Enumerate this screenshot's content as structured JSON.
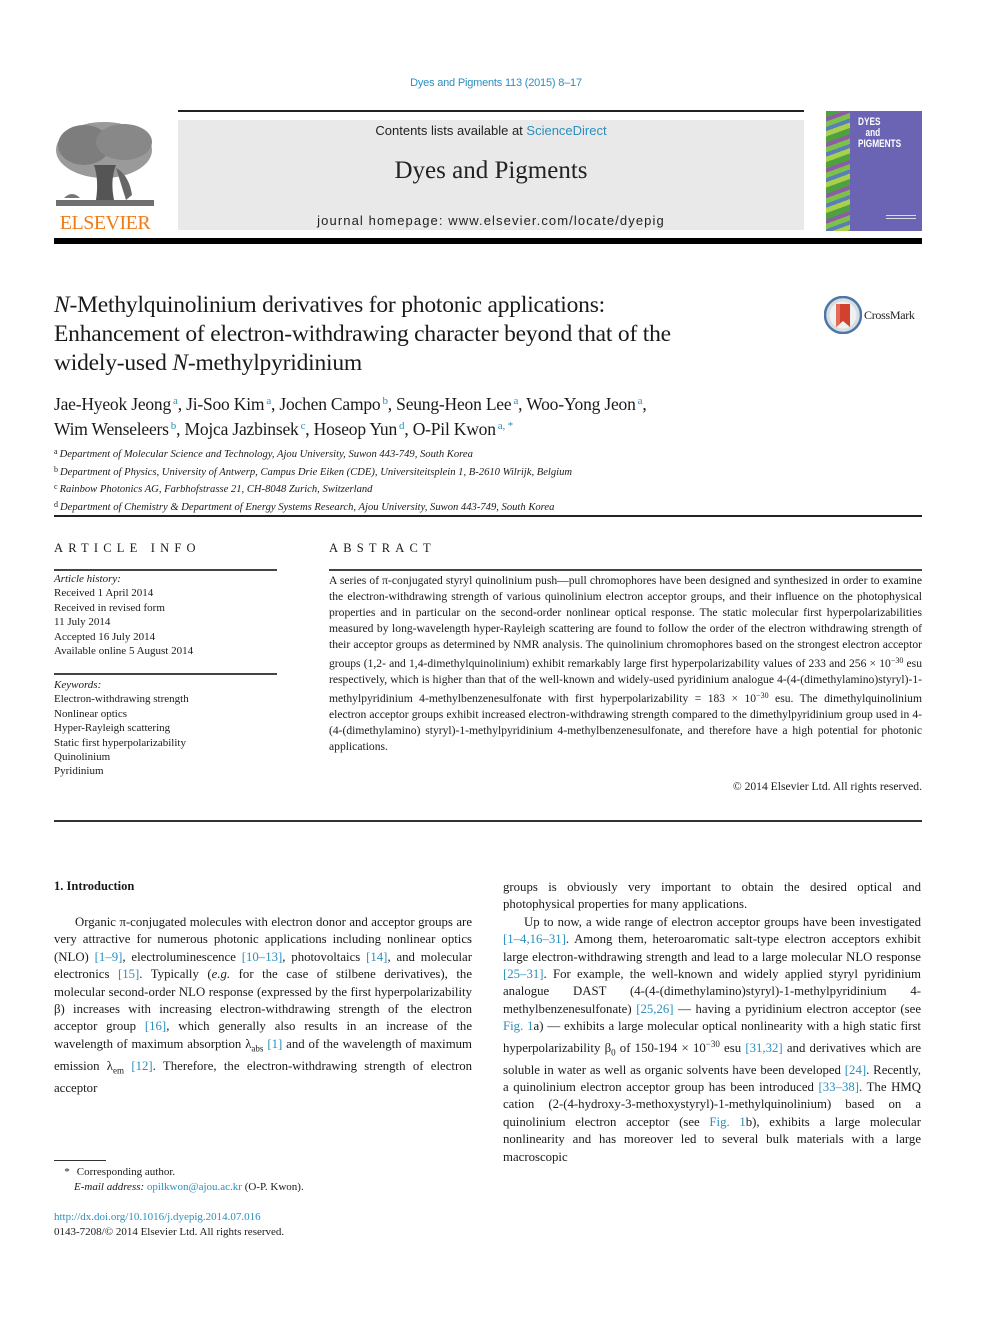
{
  "header": {
    "citation": "Dyes and Pigments 113 (2015) 8–17",
    "contents_prefix": "Contents lists available at ",
    "contents_link": "ScienceDirect",
    "journal_name": "Dyes and Pigments",
    "homepage": "journal homepage: www.elsevier.com/locate/dyepig",
    "publisher_logo": "ELSEVIER",
    "cover": {
      "line1": "DYES",
      "line2": "and",
      "line3": "PIGMENTS"
    },
    "crossmark_label": "CrossMark"
  },
  "article": {
    "title": {
      "line1_italic": "N",
      "line1_rest": "-Methylquinolinium derivatives for photonic applications:",
      "line2": "Enhancement of electron-withdrawing character beyond that of the",
      "line3_pre": "widely-used ",
      "line3_italic": "N",
      "line3_rest": "-methylpyridinium"
    },
    "authors": [
      {
        "name": "Jae-Hyeok Jeong",
        "aff": "a",
        "sep": ", "
      },
      {
        "name": "Ji-Soo Kim",
        "aff": "a",
        "sep": ", "
      },
      {
        "name": "Jochen Campo",
        "aff": "b",
        "sep": ", "
      },
      {
        "name": "Seung-Heon Lee",
        "aff": "a",
        "sep": ", "
      },
      {
        "name": "Woo-Yong Jeon",
        "aff": "a",
        "sep": ","
      },
      {
        "name": "Wim Wenseleers",
        "aff": "b",
        "sep": ", "
      },
      {
        "name": "Mojca Jazbinsek",
        "aff": "c",
        "sep": ", "
      },
      {
        "name": "Hoseop Yun",
        "aff": "d",
        "sep": ", "
      },
      {
        "name": "O-Pil Kwon",
        "aff": "a, *",
        "sep": ""
      }
    ],
    "affiliations": [
      {
        "key": "a",
        "text": "Department of Molecular Science and Technology, Ajou University, Suwon 443-749, South Korea"
      },
      {
        "key": "b",
        "text": "Department of Physics, University of Antwerp, Campus Drie Eiken (CDE), Universiteitsplein 1, B-2610 Wilrijk, Belgium"
      },
      {
        "key": "c",
        "text": "Rainbow Photonics AG, Farbhofstrasse 21, CH-8048 Zurich, Switzerland"
      },
      {
        "key": "d",
        "text": "Department of Chemistry & Department of Energy Systems Research, Ajou University, Suwon 443-749, South Korea"
      }
    ]
  },
  "article_info": {
    "label": "ARTICLE INFO",
    "history_head": "Article history:",
    "history": [
      "Received 1 April 2014",
      "Received in revised form",
      "11 July 2014",
      "Accepted 16 July 2014",
      "Available online 5 August 2014"
    ],
    "keywords_head": "Keywords:",
    "keywords": [
      "Electron-withdrawing strength",
      "Nonlinear optics",
      "Hyper-Rayleigh scattering",
      "Static first hyperpolarizability",
      "Quinolinium",
      "Pyridinium"
    ]
  },
  "abstract": {
    "label": "ABSTRACT",
    "part1": "A series of π-conjugated styryl quinolinium push—pull chromophores have been designed and synthesized in order to examine the electron-withdrawing strength of various quinolinium electron acceptor groups, and their influence on the photophysical properties and in particular on the second-order nonlinear optical response. The static molecular first hyperpolarizabilities measured by long-wavelength hyper-Rayleigh scattering are found to follow the order of the electron withdrawing strength of their acceptor groups as determined by NMR analysis. The quinolinium chromophores based on the strongest electron acceptor groups (1,2- and 1,4-dimethylquinolinium) exhibit remarkably large first hyperpolarizability values of 233 and 256 × 10",
    "exp1": "−30",
    "part2": " esu respectively, which is higher than that of the well-known and widely-used pyridinium analogue 4-(4-(dimethylamino)styryl)-1-methylpyridinium 4-methylbenzenesulfonate with first hyperpolarizability = 183 × 10",
    "exp2": "−30",
    "part3": " esu. The dimethylquinolinium electron acceptor groups exhibit increased electron-withdrawing strength compared to the dimethylpyridinium group used in 4-(4-(dimethylamino) styryl)-1-methylpyridinium 4-methylbenzenesulfonate, and therefore have a high potential for photonic applications.",
    "copyright": "© 2014 Elsevier Ltd. All rights reserved."
  },
  "body": {
    "section_heading": "1.  Introduction",
    "left": {
      "t1": "Organic π-conjugated molecules with electron donor and acceptor groups are very attractive for numerous photonic applications including nonlinear optics (NLO) ",
      "r1": "[1–9]",
      "t2": ", electroluminescence ",
      "r2": "[10–13]",
      "t3": ", photovoltaics ",
      "r3": "[14]",
      "t4": ", and molecular electronics ",
      "r4": "[15]",
      "t5": ". Typically (",
      "t5i": "e.g.",
      "t6": " for the case of stilbene derivatives), the molecular second-order NLO response (expressed by the first hyperpolarizability β) increases with increasing electron-withdrawing strength of the electron acceptor group ",
      "r5": "[16]",
      "t7": ", which generally also results in an increase of the wavelength of maximum absorption λ",
      "sub1": "abs",
      "t8": " ",
      "r6": "[1]",
      "t9": " and of the wavelength of maximum emission λ",
      "sub2": "em",
      "t10": " ",
      "r7": "[12]",
      "t11": ". Therefore, the electron-withdrawing strength of electron acceptor"
    },
    "right": {
      "p1": "groups is obviously very important to obtain the desired optical and photophysical properties for many applications.",
      "t1": "Up to now, a wide range of electron acceptor groups have been investigated ",
      "r1": "[1–4,16–31]",
      "t2": ". Among them, heteroaromatic salt-type electron acceptors exhibit large electron-withdrawing strength and lead to a large molecular NLO response ",
      "r2": "[25–31]",
      "t3": ". For example, the well-known and widely applied styryl pyridinium analogue DAST (4-(4-(dimethylamino)styryl)-1-methylpyridinium 4-methylbenzenesulfonate) ",
      "r3": "[25,26]",
      "t4": " — having a pyridinium electron acceptor (see ",
      "r4": "Fig. 1",
      "t5": "a) — exhibits a large molecular optical nonlinearity with a high static first hyperpolarizability β",
      "sub1": "0",
      "t6": " of 150-194 × 10",
      "sup1": "−30",
      "t7": " esu ",
      "r5": "[31,32]",
      "t8": " and derivatives which are soluble in water as well as organic solvents have been developed ",
      "r6": "[24]",
      "t9": ". Recently, a quinolinium electron acceptor group has been introduced ",
      "r7": "[33–38]",
      "t10": ". The HMQ cation (2-(4-hydroxy-3-methoxystyryl)-1-methylquinolinium) based on a quinolinium electron acceptor (see ",
      "r8": "Fig. 1",
      "t11": "b), exhibits a large molecular nonlinearity and has moreover led to several bulk materials with a large macroscopic"
    }
  },
  "footer": {
    "star": "*",
    "corresponding": "Corresponding author.",
    "email_label": "E-mail address: ",
    "email": "opilkwon@ajou.ac.kr",
    "email_suffix": " (O-P. Kwon).",
    "doi": "http://dx.doi.org/10.1016/j.dyepig.2014.07.016",
    "issn": "0143-7208/© 2014 Elsevier Ltd. All rights reserved."
  }
}
